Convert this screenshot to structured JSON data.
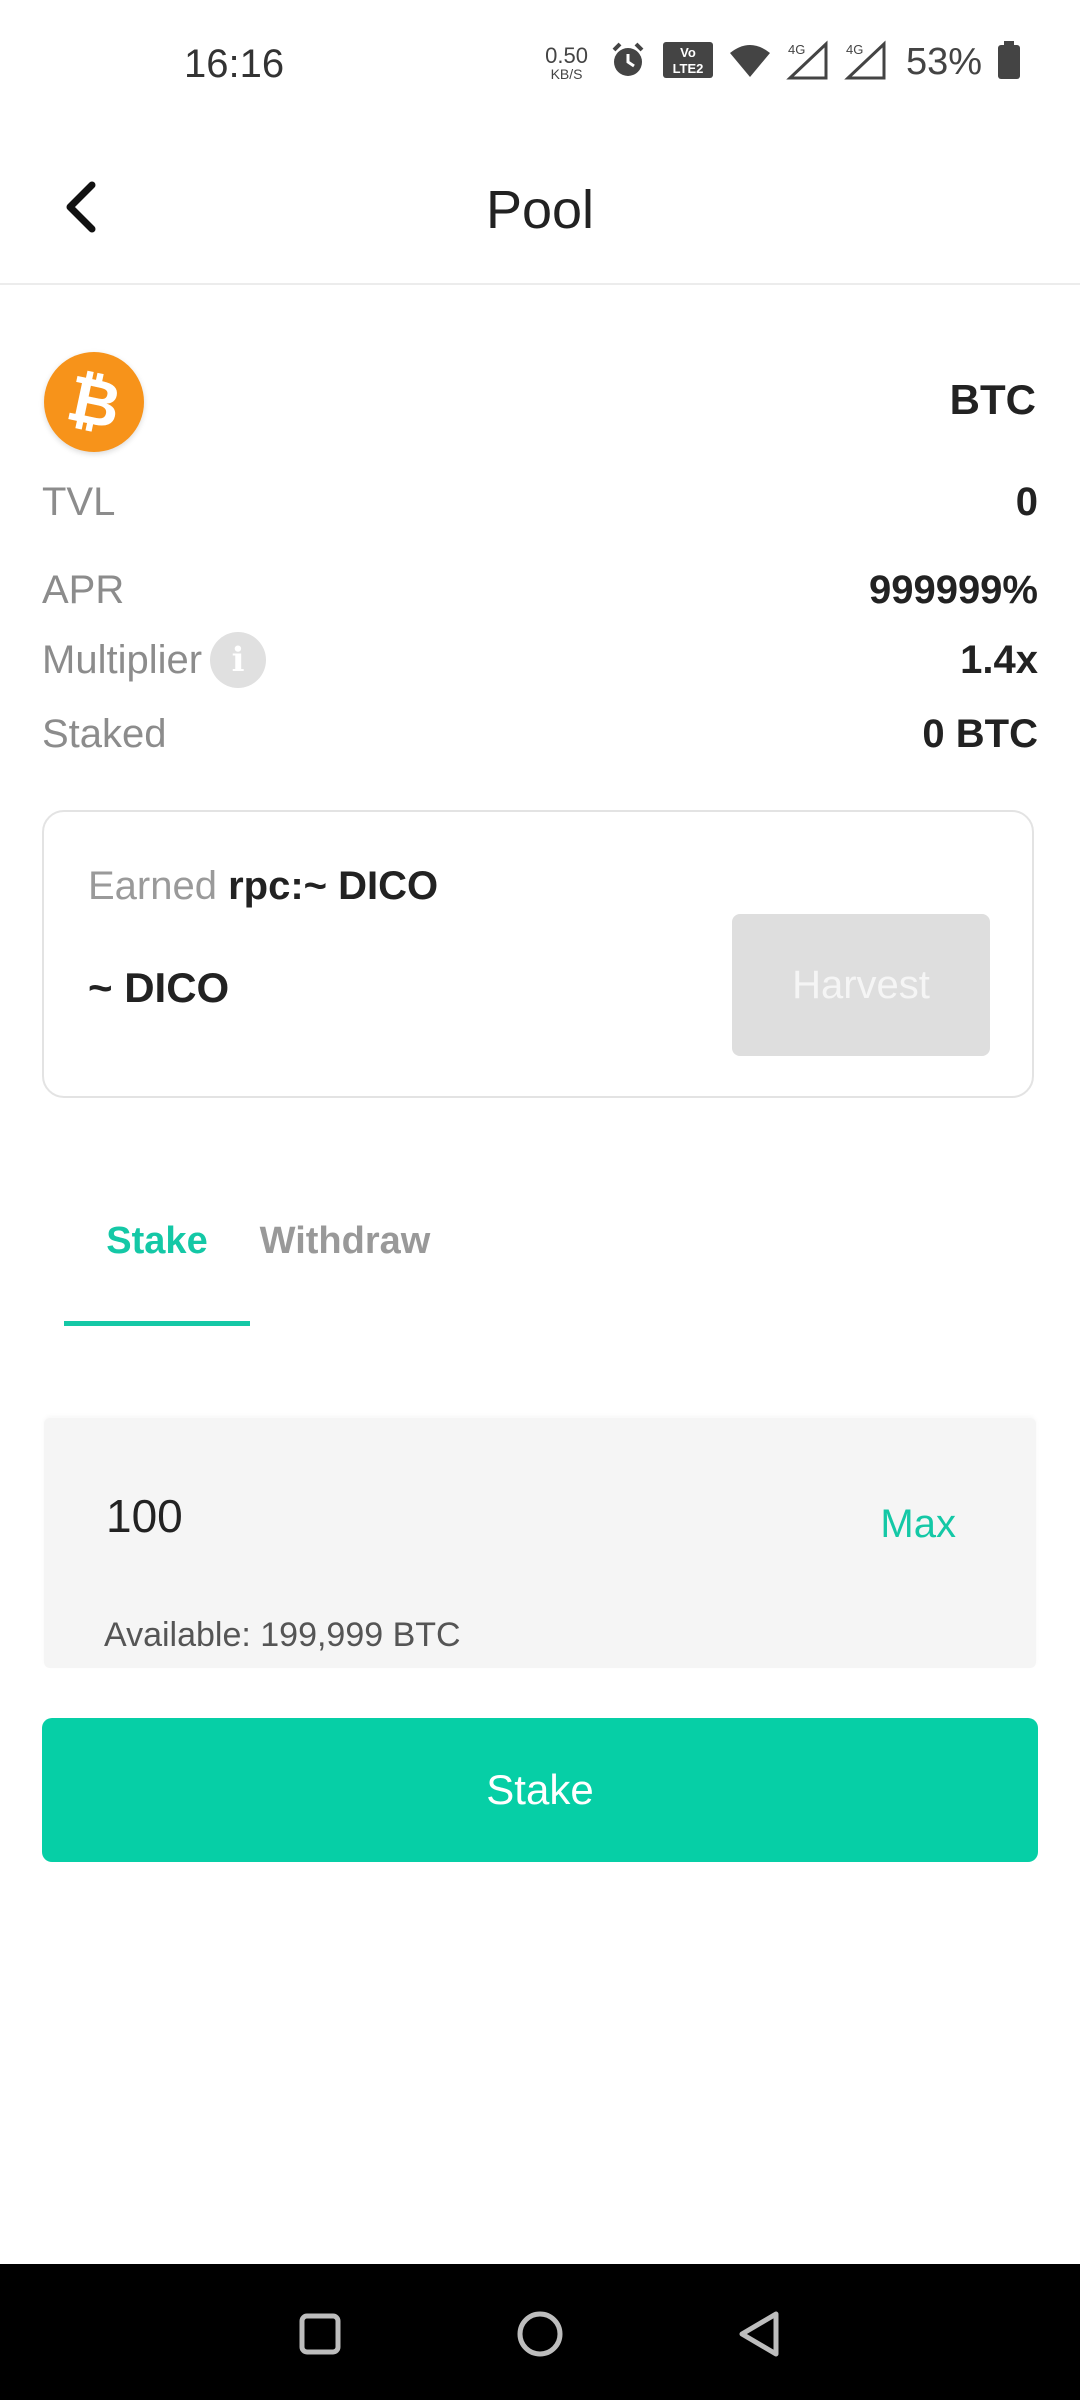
{
  "status_bar": {
    "time": "16:16",
    "net_speed_value": "0.50",
    "net_speed_unit": "KB/S",
    "battery_percent": "53%",
    "icons": [
      "alarm-icon",
      "volte-icon",
      "wifi-icon",
      "signal-4g-icon",
      "signal-4g-icon",
      "battery-icon"
    ]
  },
  "header": {
    "title": "Pool",
    "back_icon": "chevron-left-icon"
  },
  "pool": {
    "coin_logo_glyph": "₿",
    "coin_symbol": "BTC",
    "stats": [
      {
        "label": "TVL",
        "value": "0"
      },
      {
        "label": "APR",
        "value": "999999%"
      },
      {
        "label": "Multiplier",
        "value": "1.4x"
      },
      {
        "label": "Staked",
        "value": "0 BTC"
      }
    ],
    "info_glyph": "i"
  },
  "earned": {
    "label_prefix": "Earned",
    "label_token": "rpc:~ DICO",
    "amount": "~ DICO",
    "harvest_label": "Harvest"
  },
  "tabs": [
    {
      "label": "Stake",
      "active": true
    },
    {
      "label": "Withdraw",
      "active": false
    }
  ],
  "stake_form": {
    "amount_value": "100",
    "max_label": "Max",
    "available_text": "Available: 199,999 BTC",
    "submit_label": "Stake"
  },
  "colors": {
    "accent": "#06cfa6",
    "btc_orange": "#f7931a",
    "label_gray": "#8c8c8c",
    "disabled_button": "#dedede"
  }
}
